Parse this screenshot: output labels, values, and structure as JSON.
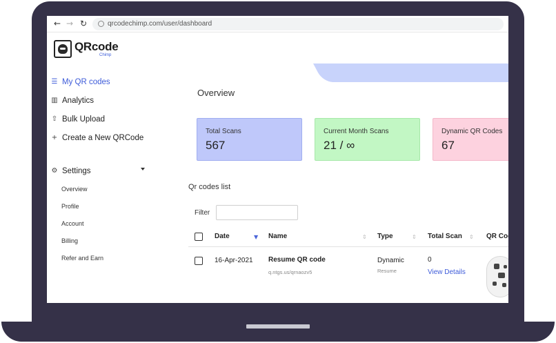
{
  "browser": {
    "url": "qrcodechimp.com/user/dashboard"
  },
  "logo": {
    "text": "QRcode",
    "sub": "Chimp"
  },
  "sidebar": {
    "items": [
      {
        "label": "My QR codes",
        "icon": "stack-icon"
      },
      {
        "label": "Analytics",
        "icon": "bar-chart-icon"
      },
      {
        "label": "Bulk Upload",
        "icon": "upload-icon"
      },
      {
        "label": "Create a New QRCode",
        "icon": "plus-icon"
      }
    ],
    "settings": {
      "label": "Settings",
      "icon": "gear-icon",
      "sub_items": [
        "Overview",
        "Profile",
        "Account",
        "Billing",
        "Refer and Earn"
      ]
    }
  },
  "main": {
    "title": "Overview",
    "cards": [
      {
        "label": "Total Scans",
        "value": "567",
        "color": "#bfc8fa"
      },
      {
        "label": "Current Month Scans",
        "value": "21 / ∞",
        "color": "#c2f7c4"
      },
      {
        "label": "Dynamic QR Codes",
        "value": "67",
        "color": "#fdd2df"
      }
    ],
    "list_title": "Qr codes list",
    "filter": {
      "label": "Filter",
      "value": "",
      "placeholder": ""
    },
    "table": {
      "headers": [
        "Date",
        "Name",
        "Type",
        "Total Scan",
        "QR Cod"
      ],
      "rows": [
        {
          "date": "16-Apr-2021",
          "name": "Resume QR code",
          "url": "q.ntgs.us/qrnaozv5",
          "type": "Dynamic",
          "subtype": "Resume",
          "total_scan": "0",
          "details_link": "View Details"
        }
      ]
    }
  },
  "colors": {
    "accent": "#3d5bd9",
    "frame": "#353148"
  }
}
